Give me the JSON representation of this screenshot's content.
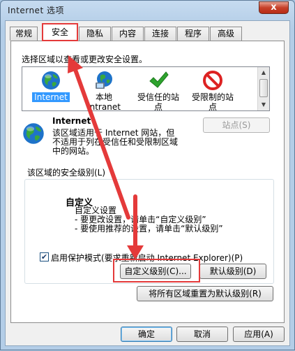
{
  "window": {
    "title": "Internet 选项",
    "close_glyph": "x"
  },
  "tabs": [
    {
      "label": "常规"
    },
    {
      "label": "安全"
    },
    {
      "label": "隐私"
    },
    {
      "label": "内容"
    },
    {
      "label": "连接"
    },
    {
      "label": "程序"
    },
    {
      "label": "高级"
    }
  ],
  "active_tab": "安全",
  "security": {
    "instruction": "选择区域以查看或更改安全设置。",
    "zones": [
      {
        "label": "Internet",
        "icon": "globe-icon",
        "selected": true
      },
      {
        "label": "本地\nIntranet",
        "icon": "local-intranet-icon"
      },
      {
        "label": "受信任的站\n点",
        "icon": "check-icon"
      },
      {
        "label": "受限制的站\n点",
        "icon": "restricted-icon"
      }
    ],
    "zone_title": "Internet",
    "zone_desc_lines": [
      "该区域适用于 Internet 网站，但",
      "不适用于列在受信任和受限制区域",
      "中的网站。"
    ],
    "sites_button": "站点(S)",
    "level_group_label": "该区域的安全级别(L)",
    "custom_title": "自定义",
    "custom_lines": [
      "自定义设置",
      "- 要更改设置，请单击“自定义级别”",
      "- 要使用推荐的设置，请单击“默认级别”"
    ],
    "protected_mode_label": "启用保护模式(要求重新启动 Internet Explorer)(P)",
    "protected_mode_checked": true,
    "custom_level_button": "自定义级别(C)...",
    "default_level_button": "默认级别(D)",
    "reset_all_button": "将所有区域重置为默认级别(R)"
  },
  "footer": {
    "ok": "确定",
    "cancel": "取消",
    "apply": "应用(A)"
  },
  "colors": {
    "highlight": "#e43a3a",
    "selection": "#3399ff"
  }
}
